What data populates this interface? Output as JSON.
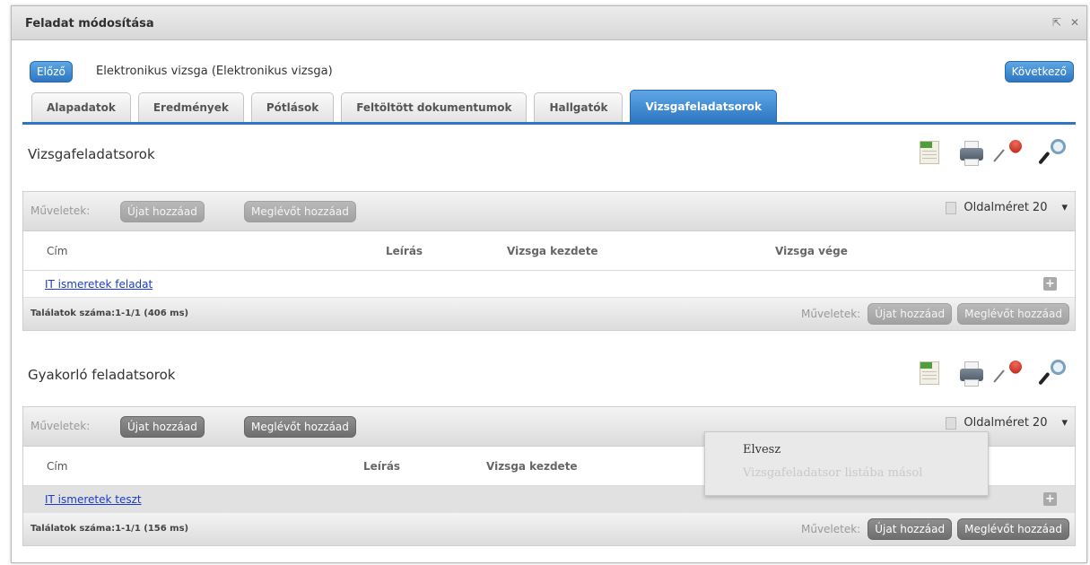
{
  "window": {
    "title": "Feladat módosítása",
    "controls": [
      "restore-icon",
      "close-icon"
    ]
  },
  "nav": {
    "prev_label": "Előző",
    "record_title": "Elektronikus vizsga (Elektronikus vizsga)",
    "next_label": "Következő"
  },
  "tabs": [
    {
      "label": "Alapadatok",
      "active": false
    },
    {
      "label": "Eredmények",
      "active": false
    },
    {
      "label": "Pótlások",
      "active": false
    },
    {
      "label": "Feltöltött dokumentumok",
      "active": false
    },
    {
      "label": "Hallgatók",
      "active": false
    },
    {
      "label": "Vizsgafeladatsorok",
      "active": true
    }
  ],
  "icons": [
    "excel-export-icon",
    "print-icon",
    "pin-icon",
    "search-icon"
  ],
  "sections": [
    {
      "title": "Vizsgafeladatsorok",
      "toolbar": {
        "ops_label": "Műveletek:",
        "add_new": "Újat hozzáad",
        "add_existing": "Meglévőt hozzáad",
        "page_size_label": "Oldalméret",
        "page_size": "20"
      },
      "columns": [
        "Cím",
        "Leírás",
        "Vizsga kezdete",
        "Vizsga vége"
      ],
      "rows": [
        {
          "title": "IT ismeretek feladat"
        }
      ],
      "footer": {
        "count": "Találatok száma:1-1/1 (406 ms)",
        "ops_label": "Műveletek:",
        "add_new": "Újat hozzáad",
        "add_existing": "Meglévőt hozzáad"
      }
    },
    {
      "title": "Gyakorló feladatsorok",
      "toolbar": {
        "ops_label": "Műveletek:",
        "add_new": "Újat hozzáad",
        "add_existing": "Meglévőt hozzáad",
        "page_size_label": "Oldalméret",
        "page_size": "20"
      },
      "columns": [
        "Cím",
        "Leírás",
        "Vizsga kezdete"
      ],
      "rows": [
        {
          "title": "IT ismeretek teszt"
        }
      ],
      "footer": {
        "count": "Találatok száma:1-1/1 (156 ms)",
        "ops_label": "Műveletek:",
        "add_new": "Újat hozzáad",
        "add_existing": "Meglévőt hozzáad"
      }
    }
  ],
  "context_menu": {
    "item1": "Elvesz",
    "item2": "Vizsgafeladatsor listába másol"
  }
}
